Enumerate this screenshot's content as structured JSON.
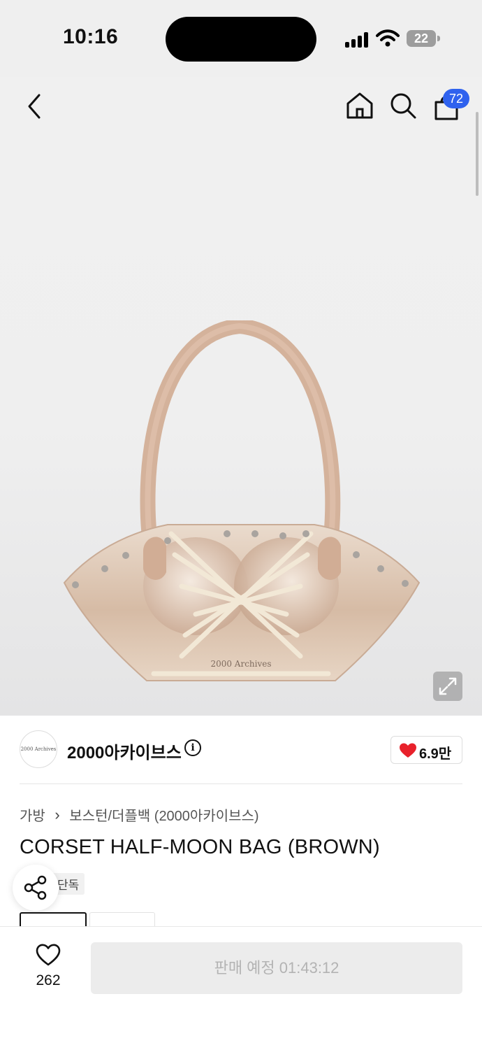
{
  "status_bar": {
    "time": "10:16",
    "battery": "22"
  },
  "header": {
    "back_icon": "chevron-left-icon",
    "home_icon": "home-icon",
    "search_icon": "search-icon",
    "cart_icon": "shopping-bag-icon",
    "cart_count": "72"
  },
  "product": {
    "image_alt": "CORSET HALF-MOON BAG (BROWN)",
    "expand_icon": "expand-icon",
    "brand": {
      "logo_text": "2000 Archives",
      "name": "2000아카이브스",
      "info_icon": "info-icon"
    },
    "likes": "6.9만",
    "breadcrumb": [
      "가방",
      "보스턴/더플백 (2000아카이브스)"
    ],
    "title": "CORSET HALF-MOON BAG (BROWN)",
    "badge": "단독",
    "share_icon": "share-icon"
  },
  "bottom_bar": {
    "wish_count": "262",
    "buy_label": "판매 예정 01:43:12"
  },
  "colors": {
    "accent": "#2f62ee",
    "heart": "#e8212b",
    "disabled_button": "#ececec"
  }
}
